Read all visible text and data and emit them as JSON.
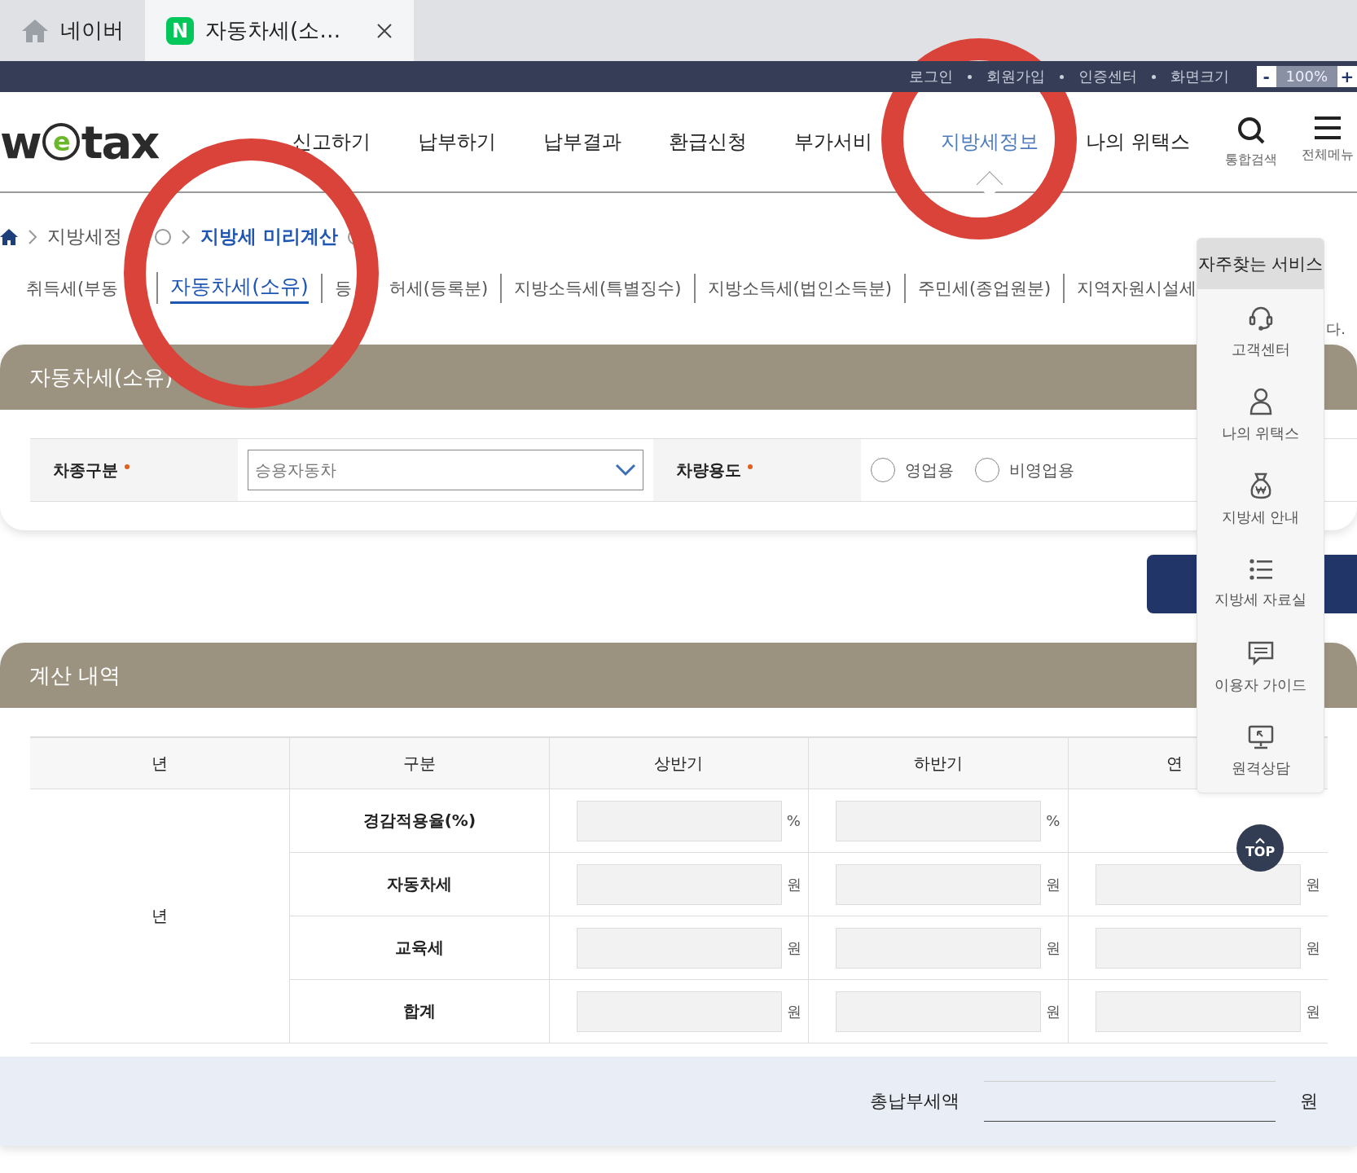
{
  "browser_tabs": [
    {
      "label": "네이버",
      "selected": false
    },
    {
      "label": "자동차세(소…",
      "selected": true,
      "favicon": "N"
    }
  ],
  "utility_links": [
    "로그인",
    "회원가입",
    "인증센터",
    "화면크기"
  ],
  "zoom": {
    "minus": "-",
    "value": "100%",
    "plus": "+"
  },
  "logo": {
    "before": "w",
    "mark": "e",
    "after": "tax"
  },
  "nav": [
    {
      "label": "신고하기",
      "selected": false
    },
    {
      "label": "납부하기",
      "selected": false
    },
    {
      "label": "납부결과",
      "selected": false
    },
    {
      "label": "환급신청",
      "selected": false
    },
    {
      "label": "부가서비",
      "selected": false
    },
    {
      "label": "지방세정보",
      "selected": true
    },
    {
      "label": "나의 위택스",
      "selected": false
    }
  ],
  "nav_tools": [
    {
      "label": "통합검색",
      "kind": "search"
    },
    {
      "label": "전체메뉴",
      "kind": "menu"
    }
  ],
  "breadcrumb": [
    {
      "label": "지방세정",
      "current": false
    },
    {
      "label": "지방세 미리계산",
      "current": true
    }
  ],
  "subtabs": [
    {
      "label": "취득세(부동",
      "selected": false
    },
    {
      "label": "자동차세(소유)",
      "selected": true
    },
    {
      "label": "등",
      "label_after_cover": "허세(등록분)",
      "selected": false
    },
    {
      "label": "지방소득세(특별징수)",
      "selected": false
    },
    {
      "label": "지방소득세(법인소득분)",
      "selected": false
    },
    {
      "label": "주민세(종업원분)",
      "selected": false
    },
    {
      "label": "지역자원시설세",
      "selected": false
    }
  ],
  "notice": "다.",
  "vehicle_form": {
    "title": "자동차세(소유)",
    "fields": [
      {
        "label": "차종구분",
        "required": true,
        "kind": "select",
        "value": "승용자동차"
      },
      {
        "label": "차량용도",
        "required": true,
        "kind": "radio",
        "options": [
          {
            "label": "영업용",
            "selected": false
          },
          {
            "label": "비영업용",
            "selected": false
          }
        ]
      }
    ]
  },
  "calc": {
    "title": "계산 내역",
    "columns": [
      "년",
      "구분",
      "상반기",
      "하반기",
      "연"
    ],
    "year_cell": "년",
    "rows": [
      {
        "label": "경감적용율(%)",
        "units": [
          "%",
          "%"
        ]
      },
      {
        "label": "자동차세",
        "units": [
          "원",
          "원",
          "원"
        ]
      },
      {
        "label": "교육세",
        "units": [
          "원",
          "원",
          "원"
        ]
      },
      {
        "label": "합계",
        "units": [
          "원",
          "원",
          "원"
        ]
      }
    ],
    "total": {
      "label": "총납부세액",
      "unit": "원"
    }
  },
  "quick_panel": {
    "title": "자주찾는 서비스",
    "items": [
      "고객센터",
      "나의 위택스",
      "지방세 안내",
      "지방세 자료실",
      "이용자 가이드",
      "원격상담"
    ]
  },
  "top_button": "TOP",
  "annotations": [
    {
      "kind": "circle"
    },
    {
      "kind": "circle"
    }
  ]
}
